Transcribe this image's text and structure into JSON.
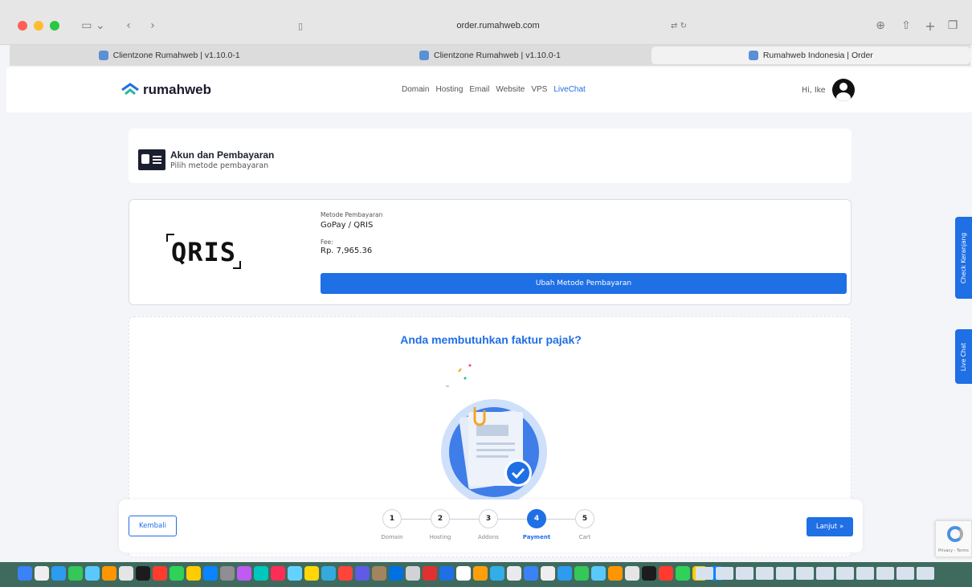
{
  "browser": {
    "url": "order.rumahweb.com",
    "tabs": [
      {
        "label": "Clientzone Rumahweb | v1.10.0-1",
        "active": false
      },
      {
        "label": "Clientzone Rumahweb | v1.10.0-1",
        "active": false
      },
      {
        "label": "Rumahweb Indonesia | Order",
        "active": true
      }
    ]
  },
  "site": {
    "logo_text": "rumahweb",
    "nav": [
      "Domain",
      "Hosting",
      "Email",
      "Website",
      "VPS",
      "LiveChat"
    ],
    "greeting": "Hi, Ike"
  },
  "account": {
    "title": "Akun dan Pembayaran",
    "subtitle": "Pilih metode pembayaran"
  },
  "payment": {
    "logo_text": "QRIS",
    "method_label": "Metode Pembayaran",
    "method_value": "GoPay / QRIS",
    "fee_label": "Fee:",
    "fee_value": "Rp. 7,965.36",
    "change_button": "Ubah Metode Pembayaran"
  },
  "tax": {
    "title": "Anda membutuhkan faktur pajak?"
  },
  "side_tabs": {
    "cart": "Check Keranjang",
    "chat": "Live Chat"
  },
  "steps": {
    "back_button": "Kembali",
    "next_button": "Lanjut »",
    "items": [
      {
        "num": "1",
        "label": "Domain"
      },
      {
        "num": "2",
        "label": "Hosting"
      },
      {
        "num": "3",
        "label": "Addons"
      },
      {
        "num": "4",
        "label": "Payment"
      },
      {
        "num": "5",
        "label": "Cart"
      }
    ],
    "active_step": 4
  },
  "recaptcha_text": "Privacy - Terms",
  "colors": {
    "accent": "#1f6fe5",
    "dark": "#1b1f2e"
  }
}
